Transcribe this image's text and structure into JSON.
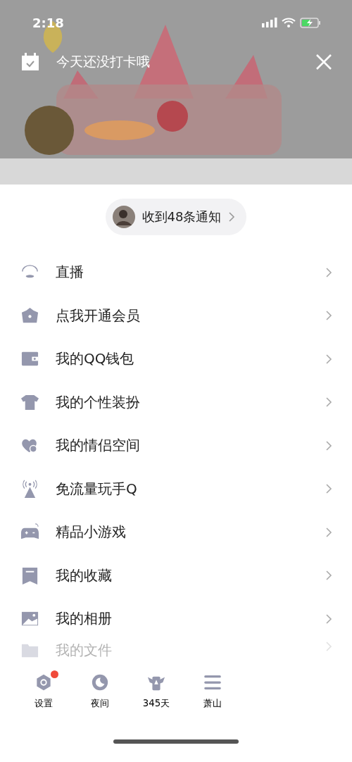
{
  "status_bar": {
    "time": "2:18"
  },
  "checkin": {
    "text": "今天还没打卡哦"
  },
  "notification": {
    "text": "收到48条通知"
  },
  "menu": [
    {
      "kind": "live",
      "label": "直播",
      "faded": false
    },
    {
      "kind": "vip",
      "label": "点我开通会员",
      "faded": false
    },
    {
      "kind": "wallet",
      "label": "我的QQ钱包",
      "faded": false
    },
    {
      "kind": "shirt",
      "label": "我的个性装扮",
      "faded": false
    },
    {
      "kind": "hearts",
      "label": "我的情侣空间",
      "faded": false
    },
    {
      "kind": "signal",
      "label": "免流量玩手Q",
      "faded": false
    },
    {
      "kind": "gamepad",
      "label": "精品小游戏",
      "faded": false
    },
    {
      "kind": "bookmark",
      "label": "我的收藏",
      "faded": false
    },
    {
      "label": "我的相册",
      "faded": false
    },
    {
      "kind": "folder",
      "label": "我的文件",
      "faded": true
    }
  ],
  "bottom_bar": [
    {
      "kind": "settings",
      "label": "设置",
      "badge": true
    },
    {
      "kind": "night",
      "label": "夜间",
      "badge": false
    },
    {
      "kind": "wings",
      "label": "345天",
      "badge": false
    },
    {
      "kind": "menu",
      "label": "萧山",
      "badge": false
    }
  ]
}
